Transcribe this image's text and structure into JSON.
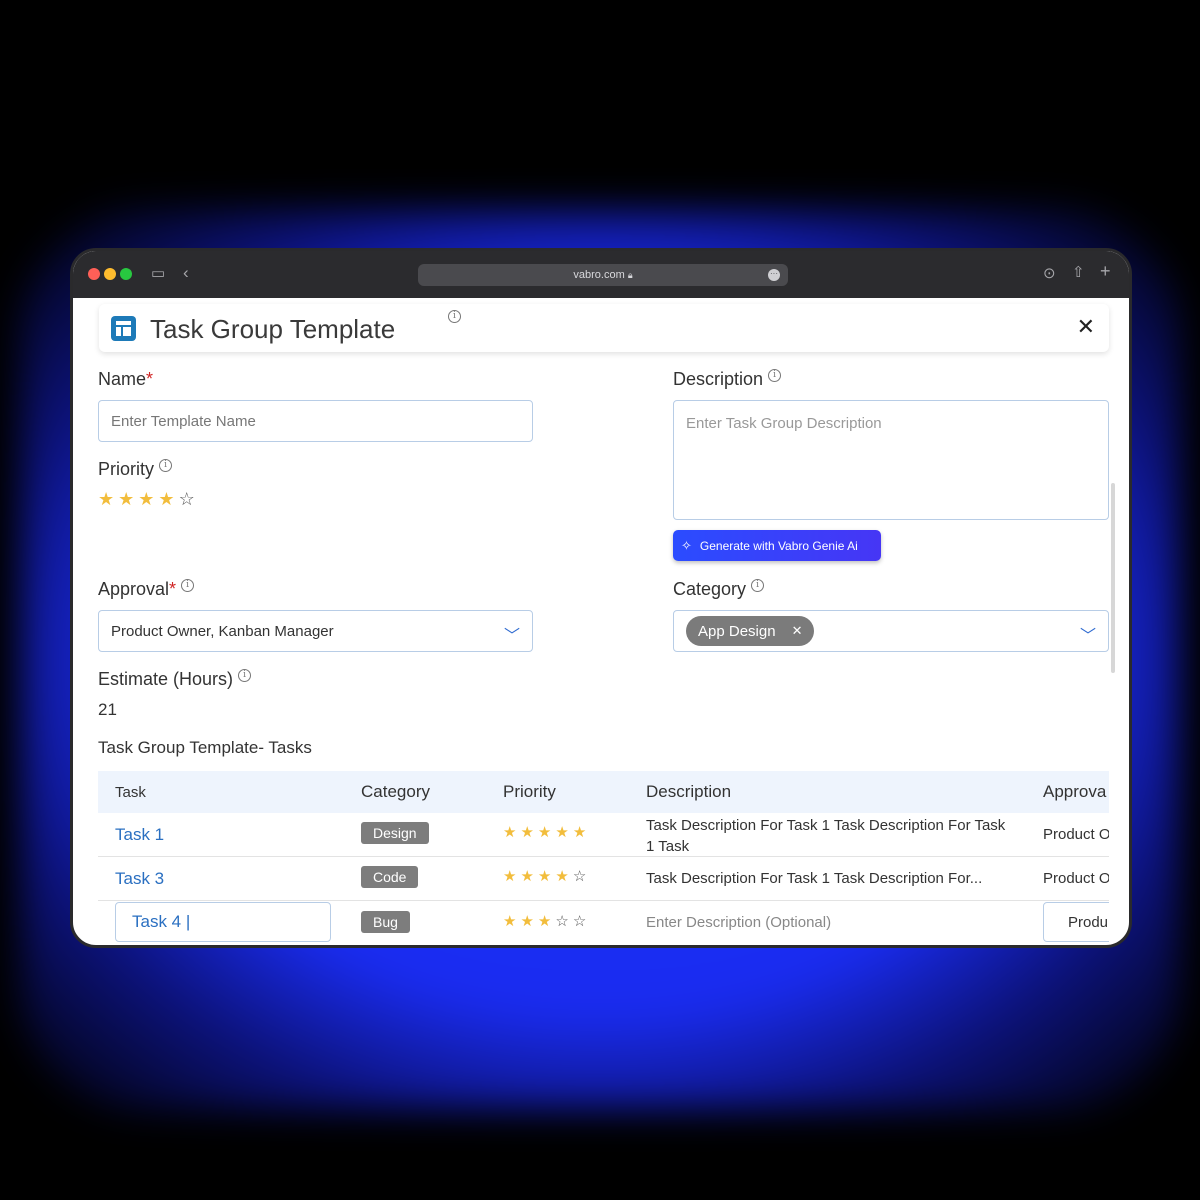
{
  "browser": {
    "url": "vabro.com"
  },
  "header": {
    "title": "Task Group Template"
  },
  "form": {
    "name_label": "Name",
    "required_mark": "*",
    "name_placeholder": "Enter Template Name",
    "description_label": "Description",
    "description_placeholder": "Enter Task Group Description",
    "priority_label": "Priority",
    "priority_rating": 4,
    "priority_max": 5,
    "genie_button": "Generate with Vabro Genie Ai",
    "approval_label": "Approval",
    "approval_value": "Product Owner, Kanban Manager",
    "category_label": "Category",
    "category_chip": "App Design",
    "estimate_label": "Estimate (Hours)",
    "estimate_value": "21"
  },
  "tasks_section": {
    "title": "Task Group Template- Tasks",
    "columns": [
      "Task",
      "Category",
      "Priority",
      "Description",
      "Approva"
    ],
    "rows": [
      {
        "task": "Task 1",
        "category": "Design",
        "priority": 5,
        "description": "Task Description For Task 1 Task Description For Task 1 Task",
        "approval": "Product O"
      },
      {
        "task": "Task 3",
        "category": "Code",
        "priority": 4,
        "description": "Task Description For Task 1 Task Description For...",
        "approval": "Product O"
      },
      {
        "task": "Task 4 |",
        "category": "Bug",
        "priority": 3,
        "description": "Enter Description (Optional)",
        "approval": "Produ"
      }
    ]
  },
  "colors": {
    "accent": "#2a6fc1",
    "star": "#f2bd3c",
    "genie_button": "#2b4cff"
  }
}
